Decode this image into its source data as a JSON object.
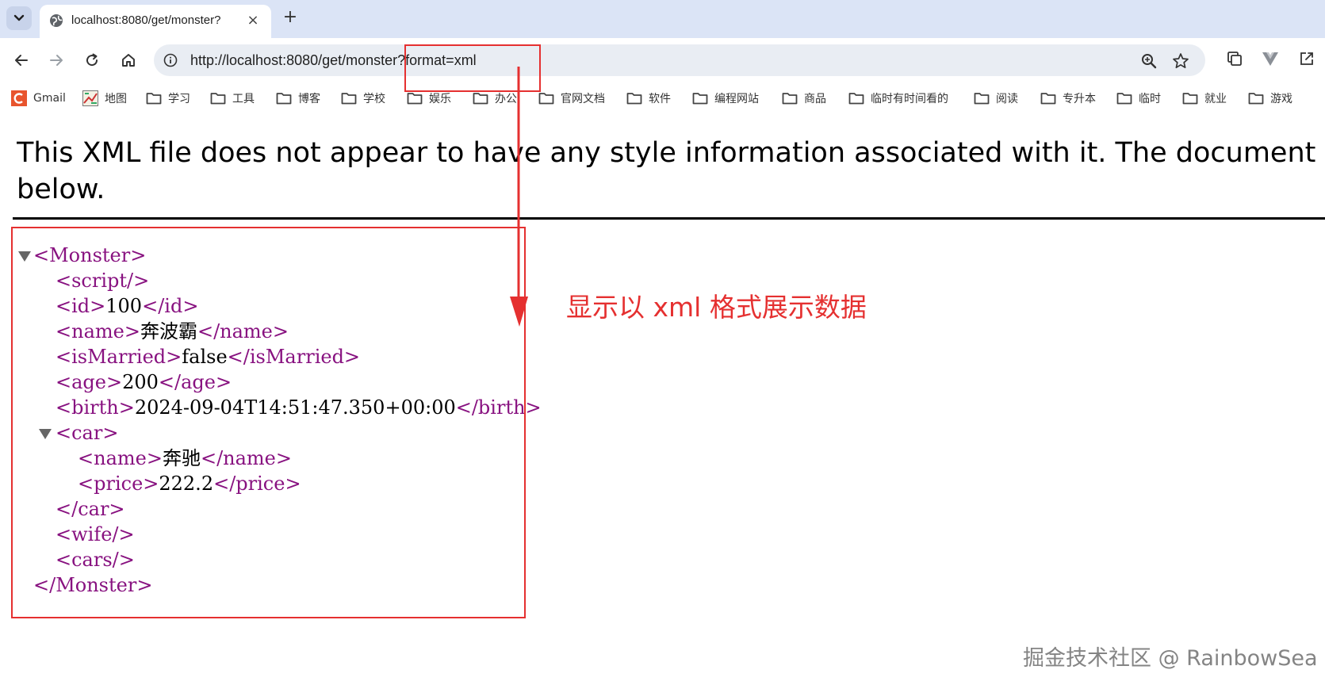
{
  "tab": {
    "title": "localhost:8080/get/monster?",
    "close_glyph": "×",
    "new_tab_glyph": "+"
  },
  "toolbar": {
    "url": "http://localhost:8080/get/monster?format=xml"
  },
  "bookmarks": [
    {
      "label": "Gmail",
      "icon": "gmail-icon"
    },
    {
      "label": "地图",
      "icon": "maps-icon"
    },
    {
      "label": "学习",
      "icon": "folder-icon"
    },
    {
      "label": "工具",
      "icon": "folder-icon"
    },
    {
      "label": "博客",
      "icon": "folder-icon"
    },
    {
      "label": "学校",
      "icon": "folder-icon"
    },
    {
      "label": "娱乐",
      "icon": "folder-icon"
    },
    {
      "label": "办公",
      "icon": "folder-icon"
    },
    {
      "label": "官网文档",
      "icon": "folder-icon"
    },
    {
      "label": "软件",
      "icon": "folder-icon"
    },
    {
      "label": "编程网站",
      "icon": "folder-icon"
    },
    {
      "label": "商品",
      "icon": "folder-icon"
    },
    {
      "label": "临时有时间看的",
      "icon": "folder-icon"
    },
    {
      "label": "阅读",
      "icon": "folder-icon"
    },
    {
      "label": "专升本",
      "icon": "folder-icon"
    },
    {
      "label": "临时",
      "icon": "folder-icon"
    },
    {
      "label": "就业",
      "icon": "folder-icon"
    },
    {
      "label": "游戏",
      "icon": "folder-icon"
    }
  ],
  "page": {
    "notice_line1": "This XML file does not appear to have any style information associated with it. The document tree is shown",
    "notice_line2": "below."
  },
  "xml_tree": [
    {
      "open": "<Monster>",
      "text": "",
      "close": "",
      "depth": 0,
      "toggle": true
    },
    {
      "open": "<script/>",
      "text": "",
      "close": "",
      "depth": 1,
      "toggle": false
    },
    {
      "open": "<id>",
      "text": "100",
      "close": "</id>",
      "depth": 1,
      "toggle": false
    },
    {
      "open": "<name>",
      "text": "奔波霸",
      "close": "</name>",
      "depth": 1,
      "toggle": false
    },
    {
      "open": "<isMarried>",
      "text": "false",
      "close": "</isMarried>",
      "depth": 1,
      "toggle": false
    },
    {
      "open": "<age>",
      "text": "200",
      "close": "</age>",
      "depth": 1,
      "toggle": false
    },
    {
      "open": "<birth>",
      "text": "2024-09-04T14:51:47.350+00:00",
      "close": "</birth>",
      "depth": 1,
      "toggle": false
    },
    {
      "open": "<car>",
      "text": "",
      "close": "",
      "depth": 1,
      "toggle": true
    },
    {
      "open": "<name>",
      "text": "奔驰",
      "close": "</name>",
      "depth": 2,
      "toggle": false
    },
    {
      "open": "<price>",
      "text": "222.2",
      "close": "</price>",
      "depth": 2,
      "toggle": false
    },
    {
      "open": "</car>",
      "text": "",
      "close": "",
      "depth": 1,
      "toggle": false
    },
    {
      "open": "<wife/>",
      "text": "",
      "close": "",
      "depth": 1,
      "toggle": false
    },
    {
      "open": "<cars/>",
      "text": "",
      "close": "",
      "depth": 1,
      "toggle": false
    },
    {
      "open": "</Monster>",
      "text": "",
      "close": "",
      "depth": 0,
      "toggle": false
    }
  ],
  "annotation": {
    "text": "显示以 xml 格式展示数据",
    "color": "#e53030"
  },
  "watermark": {
    "text": "掘金技术社区 @ RainbowSea"
  },
  "colors": {
    "tag": "#881280",
    "tabstrip": "#dbe4f6",
    "omnibox": "#e9edf3"
  }
}
